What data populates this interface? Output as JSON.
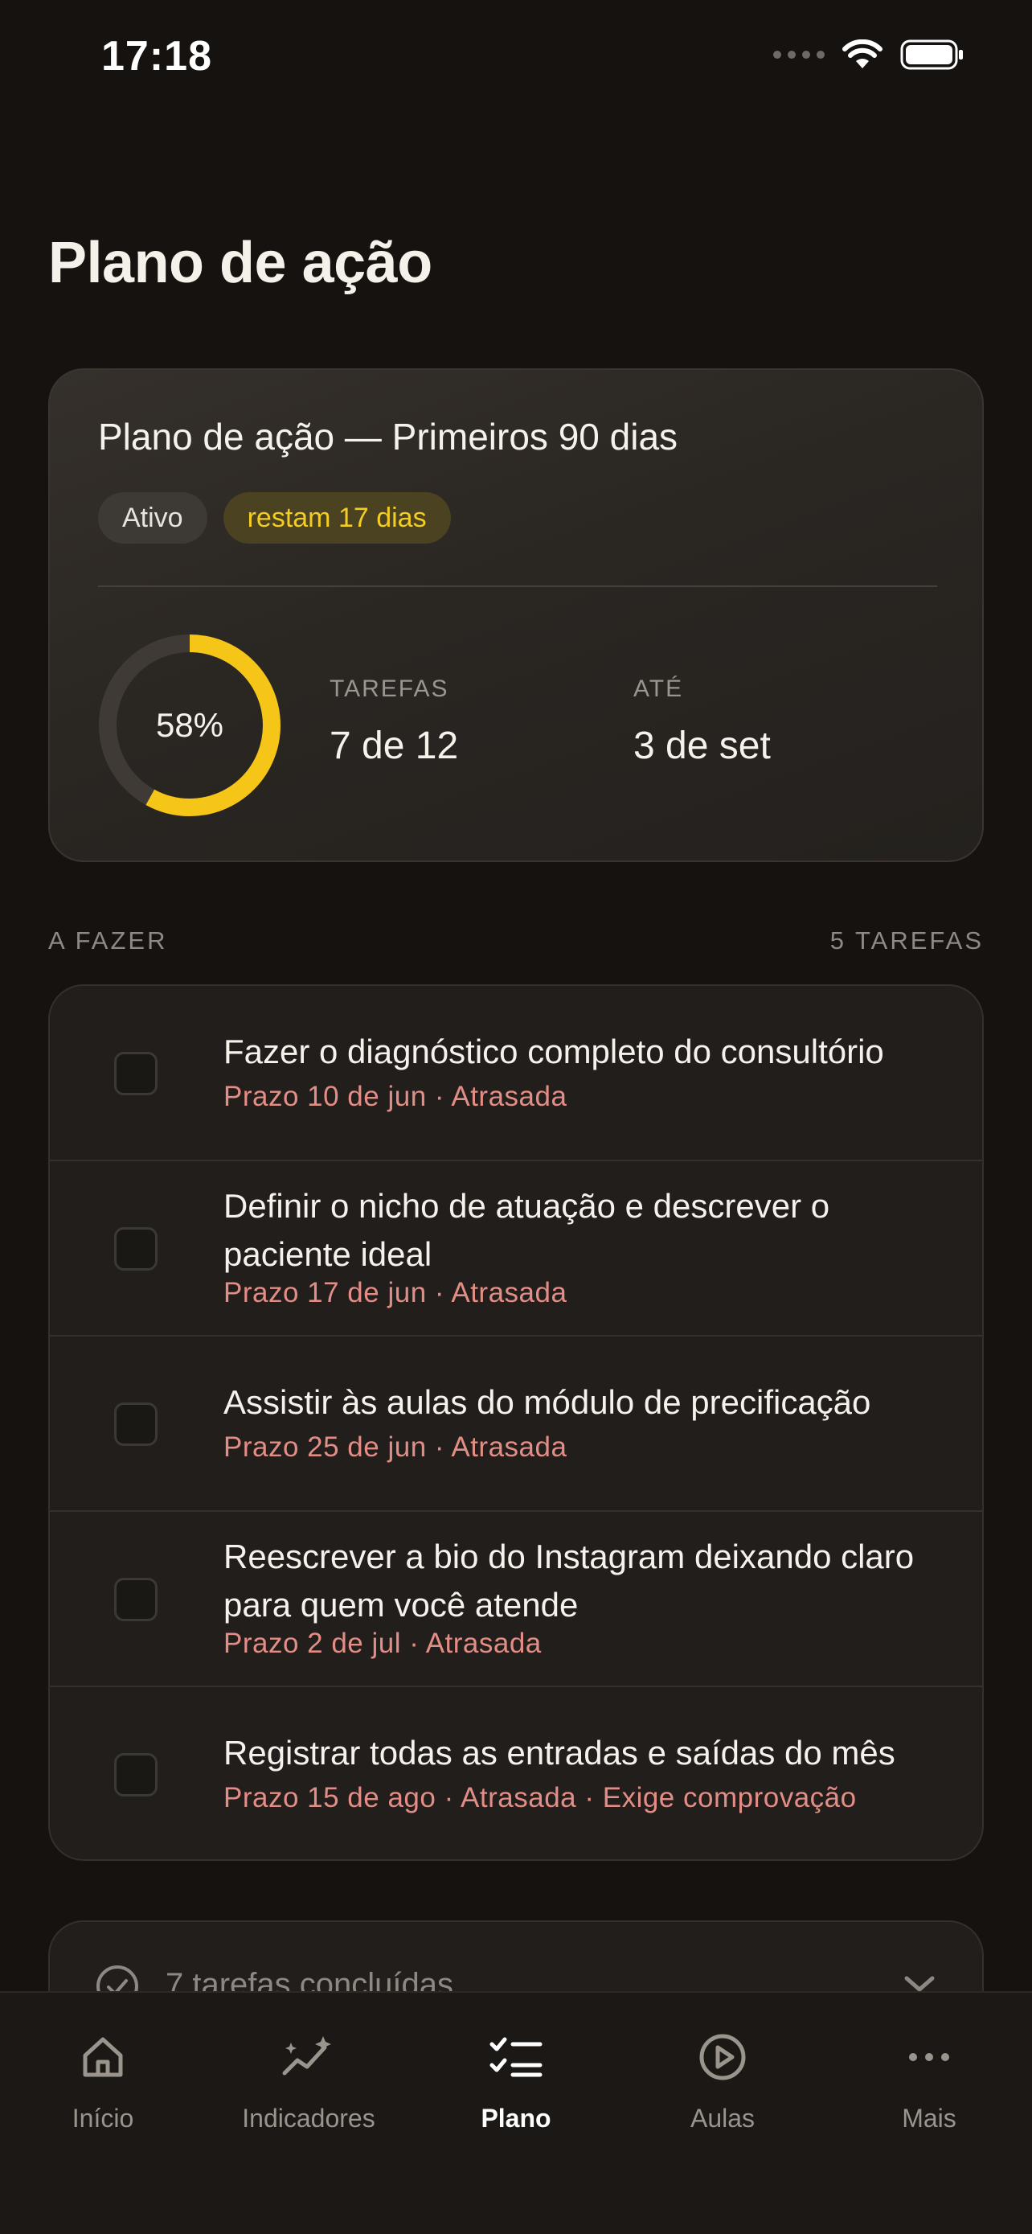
{
  "status_bar": {
    "time": "17:18"
  },
  "page_title": "Plano de ação",
  "plan": {
    "title": "Plano de ação — Primeiros 90 dias",
    "badge_status": "Ativo",
    "badge_remaining": "restam 17 dias",
    "progress_percent": 58,
    "progress_label": "58%",
    "tasks_label": "TAREFAS",
    "tasks_value": "7 de 12",
    "until_label": "ATÉ",
    "until_value": "3 de set",
    "colors": {
      "accent": "#f5c518",
      "ring_track": "#3f3a35"
    }
  },
  "todo": {
    "heading": "A FAZER",
    "count": "5 TAREFAS",
    "tasks": [
      {
        "title": "Fazer o diagnóstico completo do consultório",
        "meta": "Prazo 10 de jun · Atrasada"
      },
      {
        "title": "Definir o nicho de atuação e descrever o paciente ideal",
        "meta": "Prazo 17 de jun · Atrasada"
      },
      {
        "title": "Assistir às aulas do módulo de precificação",
        "meta": "Prazo 25 de jun · Atrasada"
      },
      {
        "title": "Reescrever a bio do Instagram deixando claro para quem você atende",
        "meta": "Prazo 2 de jul · Atrasada"
      },
      {
        "title": "Registrar todas as entradas e saídas do mês",
        "meta": "Prazo 15 de ago · Atrasada · Exige comprovação"
      }
    ]
  },
  "done": {
    "label": "7 tarefas concluídas"
  },
  "tabs": [
    {
      "label": "Início",
      "icon": "home-icon"
    },
    {
      "label": "Indicadores",
      "icon": "sparkline-icon"
    },
    {
      "label": "Plano",
      "icon": "checklist-icon",
      "active": true
    },
    {
      "label": "Aulas",
      "icon": "play-circle-icon"
    },
    {
      "label": "Mais",
      "icon": "more-icon"
    }
  ]
}
